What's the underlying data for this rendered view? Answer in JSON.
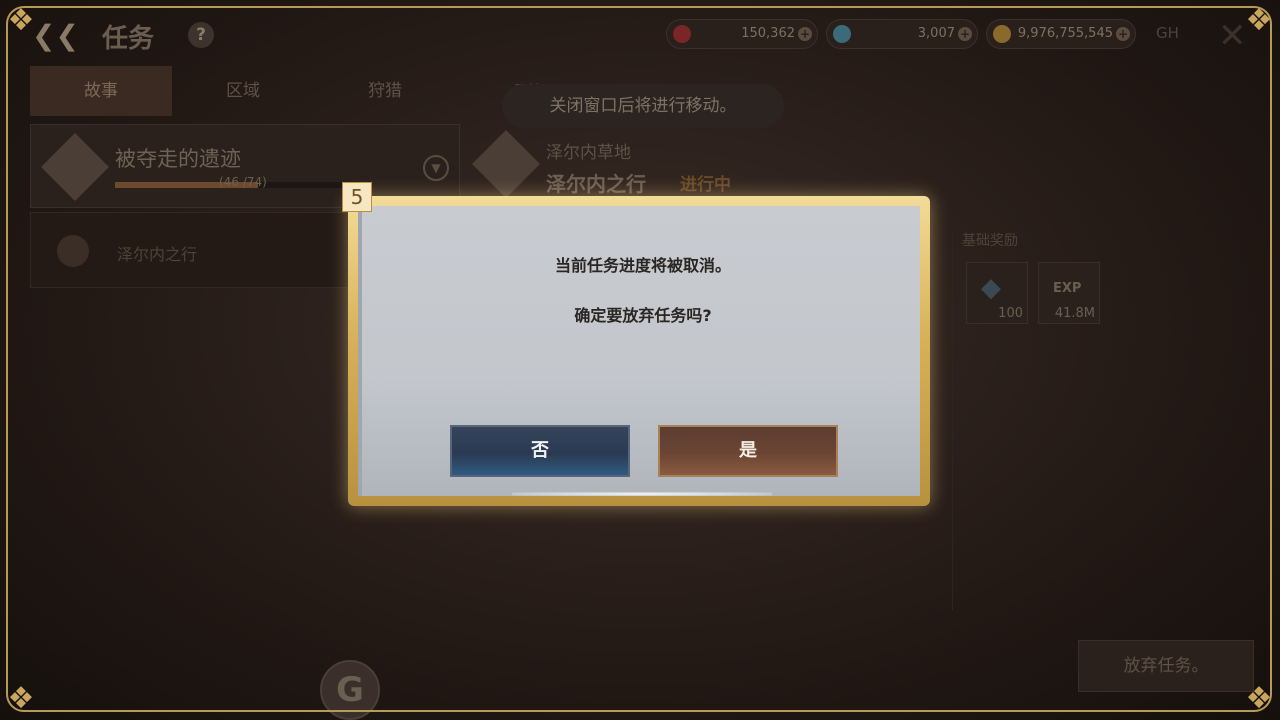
{
  "header": {
    "title": "任务",
    "help_label": "?",
    "currencies": [
      {
        "name": "ruby",
        "value": "150,362",
        "color": "#8a2a2a"
      },
      {
        "name": "diamond",
        "value": "3,007",
        "color": "#3b7a8a"
      },
      {
        "name": "gold",
        "value": "9,976,755,545",
        "color": "#8a6a2a"
      }
    ],
    "extra_label": "GH"
  },
  "tabs": [
    "故事",
    "区域",
    "狩猎"
  ],
  "quest_list": {
    "main_quest": {
      "name": "被夺走的遗迹",
      "progress_text": "(46 /74)",
      "progress": 0.62
    },
    "sub_item": {
      "label": "泽尔内之行"
    }
  },
  "toast": {
    "tab_hint": "开始",
    "message": "关闭窗口后将进行移动。"
  },
  "detail": {
    "region": "泽尔内草地",
    "name": "泽尔内之行",
    "status": "进行中",
    "reward_label": "基础奖励",
    "rewards": [
      {
        "type": "diamond",
        "value": "100"
      },
      {
        "type": "exp",
        "label": "EXP",
        "value": "41.8M"
      }
    ]
  },
  "abandon_button": "放弃任务。",
  "g_button": "G",
  "modal": {
    "badge": "5",
    "line1": "当前任务进度将被取消。",
    "line2": "确定要放弃任务吗?",
    "no_label": "否",
    "yes_label": "是"
  }
}
